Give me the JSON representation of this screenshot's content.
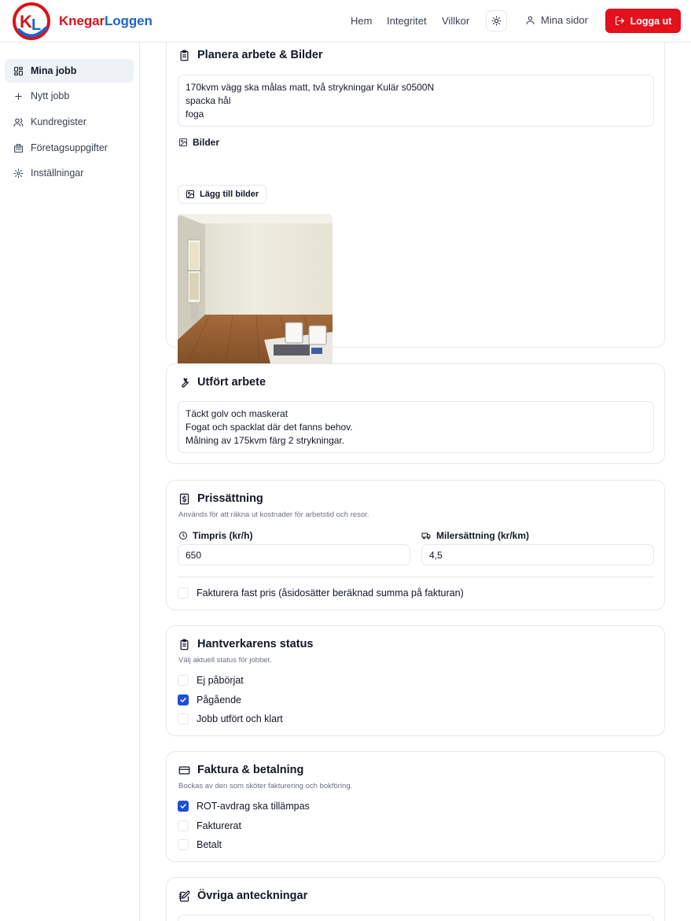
{
  "brand": {
    "part1": "Knegar",
    "part2": "Loggen",
    "logo_letters": "KL",
    "red": "#d7141a",
    "blue": "#1e63c9"
  },
  "header": {
    "nav": [
      "Hem",
      "Integritet",
      "Villkor"
    ],
    "theme_icon": "sun-icon",
    "account_label": "Mina sidor",
    "logout_label": "Logga ut",
    "logout_color": "#e3111c"
  },
  "sidebar": {
    "items": [
      {
        "label": "Mina jobb",
        "icon": "dashboard-icon",
        "active": true
      },
      {
        "label": "Nytt jobb",
        "icon": "plus-icon",
        "active": false
      },
      {
        "label": "Kundregister",
        "icon": "users-icon",
        "active": false
      },
      {
        "label": "Företagsuppgifter",
        "icon": "building-icon",
        "active": false
      },
      {
        "label": "Inställningar",
        "icon": "gear-icon",
        "active": false
      }
    ]
  },
  "plan": {
    "title": "Planera arbete & Bilder",
    "text": "170kvm  vägg ska målas matt, två strykningar Kulär s0500N\nspacka hål\nfoga",
    "images_label": "Bilder",
    "add_images_label": "Lägg till bilder"
  },
  "done": {
    "title": "Utfört arbete",
    "text": "Täckt golv och maskerat\nFogat och spacklat där det fanns behov.\nMålning av 175kvm färg 2 strykningar."
  },
  "pricing": {
    "title": "Prissättning",
    "subtitle": "Används för att räkna ut kostnader för arbetstid och resor.",
    "hourly_label": "Timpris (kr/h)",
    "hourly_value": "650",
    "mileage_label": "Milersättning (kr/km)",
    "mileage_value": "4,5",
    "fixed_price_label": "Fakturera fast pris (åsidosätter beräknad summa på fakturan)",
    "fixed_price_checked": false
  },
  "status": {
    "title": "Hantverkarens status",
    "subtitle": "Välj aktuell status för jobbet.",
    "options": [
      {
        "label": "Ej påbörjat",
        "checked": false
      },
      {
        "label": "Pågående",
        "checked": true
      },
      {
        "label": "Jobb utfört och klart",
        "checked": false
      }
    ]
  },
  "invoice": {
    "title": "Faktura & betalning",
    "subtitle": "Bockas av den som sköter fakturering och bokföring.",
    "options": [
      {
        "label": "ROT-avdrag ska tillämpas",
        "checked": true
      },
      {
        "label": "Fakturerat",
        "checked": false
      },
      {
        "label": "Betalt",
        "checked": false
      }
    ]
  },
  "notes": {
    "title": "Övriga anteckningar"
  }
}
